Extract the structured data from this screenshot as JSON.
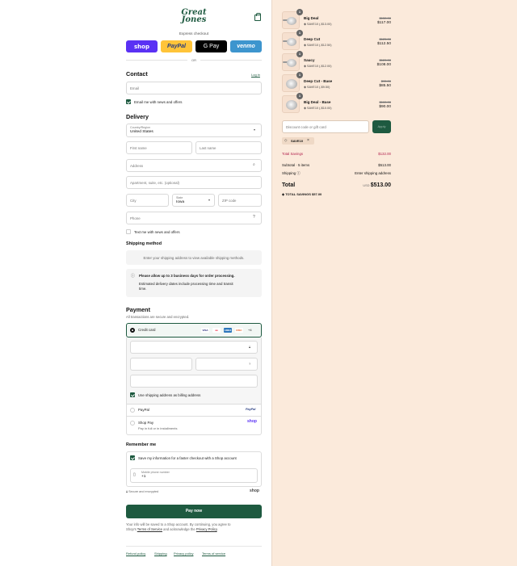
{
  "header": {
    "logo_line1": "Great",
    "logo_line2": "Jones"
  },
  "express": {
    "label": "Express checkout",
    "buttons": [
      {
        "label": "shop",
        "bg": "#5a31f4",
        "fg": "#ffffff"
      },
      {
        "label": "PayPal",
        "bg": "#ffc439",
        "fg": "#253b80"
      },
      {
        "label": "G Pay",
        "bg": "#000000",
        "fg": "#ffffff"
      },
      {
        "label": "venmo",
        "bg": "#3d95ce",
        "fg": "#ffffff"
      }
    ],
    "or": "OR"
  },
  "contact": {
    "title": "Contact",
    "login_link": "Log in",
    "email_placeholder": "Email",
    "news_label": "Email me with news and offers"
  },
  "delivery": {
    "title": "Delivery",
    "country_label": "Country/Region",
    "country_value": "United States",
    "first_name": "First name",
    "last_name": "Last name",
    "address": "Address",
    "apartment": "Apartment, suite, etc. (optional)",
    "city": "City",
    "state_label": "State",
    "state_value": "Iowa",
    "zip": "ZIP code",
    "phone": "Phone",
    "text_news_label": "Text me with news and offers"
  },
  "shipping": {
    "title": "Shipping method",
    "placeholder": "Enter your shipping address to view available shipping methods.",
    "notice_title": "Please allow up to 3 business days for order processing.",
    "notice_line1": "Estimated delivery dates include processing time and transit",
    "notice_line2": "time."
  },
  "payment": {
    "title": "Payment",
    "subtitle": "All transactions are secure and encrypted.",
    "credit_card": "Credit card",
    "card_icons": [
      {
        "label": "VISA",
        "bg": "#ffffff",
        "fg": "#1a1f71"
      },
      {
        "label": "●●",
        "bg": "#ffffff",
        "fg": "#eb001b"
      },
      {
        "label": "AMEX",
        "bg": "#2e77bc",
        "fg": "#ffffff"
      },
      {
        "label": "DISC",
        "bg": "#ffffff",
        "fg": "#e55c20"
      }
    ],
    "more_icon": "+4",
    "billing_label": "Use shipping address as billing address",
    "paypal_label": "PayPal",
    "paypal_logo": "PayPal",
    "shoppay_label": "Shop Pay",
    "shoppay_sub": "Pay in full or in installments",
    "shoppay_logo": "shop"
  },
  "remember": {
    "title": "Remember me",
    "save_label": "Save my information for a faster checkout with a Shop account",
    "phone_label": "Mobile phone number",
    "phone_value": "+1",
    "secure": "Secure and encrypted",
    "shop_logo": "shop"
  },
  "pay_now": "Pay now",
  "legal": {
    "line1": "Your info will be saved to a Shop account. By continuing, you agree to",
    "line2_pre": "Shop's ",
    "terms": "Terms of Service",
    "line2_mid": " and acknowledge the ",
    "privacy": "Privacy Policy",
    "line2_end": "."
  },
  "footer_links": [
    "Refund policy",
    "Shipping",
    "Privacy policy",
    "Terms of service"
  ],
  "cart": {
    "items": [
      {
        "qty": "1",
        "name": "Big Deal",
        "discount": "SAVE10 (-$13.00)",
        "old": "$130.00",
        "new": "$117.00"
      },
      {
        "qty": "1",
        "name": "Deep Cut",
        "discount": "SAVE10 (-$12.50)",
        "old": "$125.00",
        "new": "$112.50"
      },
      {
        "qty": "1",
        "name": "Saucy",
        "discount": "SAVE10 (-$12.00)",
        "old": "$120.00",
        "new": "$108.00"
      },
      {
        "qty": "1",
        "name": "Deep Cut - Base",
        "discount": "SAVE10 (-$9.50)",
        "old": "$95.00",
        "new": "$85.50"
      },
      {
        "qty": "1",
        "name": "Big Deal - Base",
        "discount": "SAVE10 (-$10.00)",
        "old": "$100.00",
        "new": "$90.00"
      }
    ],
    "discount_placeholder": "Discount code or gift card",
    "apply": "Apply",
    "chip": "SAVE10",
    "total_savings_label": "Total Savings",
    "total_savings_value": "$132.00",
    "subtotal_label": "Subtotal · 5 items",
    "subtotal_value": "$513.00",
    "shipping_label": "Shipping",
    "shipping_value": "Enter shipping address",
    "total_label": "Total",
    "currency": "USD",
    "total_value": "$513.00",
    "savings_footer_label": "TOTAL SAVINGS",
    "savings_footer_value": "$57.00"
  }
}
